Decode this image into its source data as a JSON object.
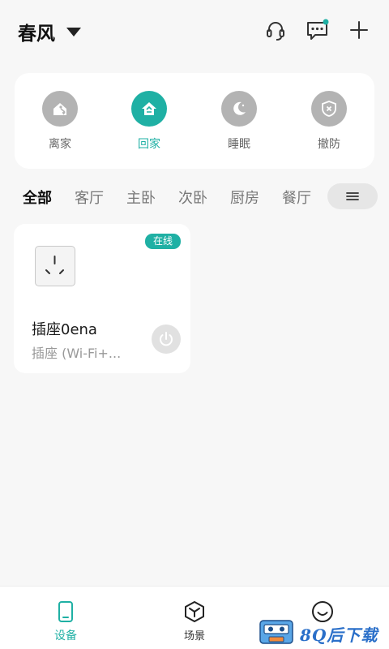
{
  "header": {
    "home_name": "春风",
    "icons": [
      "headset-icon",
      "message-icon",
      "plus-icon"
    ]
  },
  "modes": [
    {
      "label": "离家",
      "icon": "away-icon",
      "active": false
    },
    {
      "label": "回家",
      "icon": "home-icon",
      "active": true
    },
    {
      "label": "睡眠",
      "icon": "moon-icon",
      "active": false
    },
    {
      "label": "撤防",
      "icon": "shield-x-icon",
      "active": false
    }
  ],
  "rooms": {
    "tabs": [
      "全部",
      "客厅",
      "主卧",
      "次卧",
      "厨房",
      "餐厅"
    ],
    "active_index": 0,
    "menu_icon": "menu-icon"
  },
  "device": {
    "name": "插座0ena",
    "type": "插座 (Wi-Fi+...",
    "status": "在线"
  },
  "tabbar": {
    "items": [
      {
        "label": "设备",
        "icon": "phone-icon",
        "active": true
      },
      {
        "label": "场景",
        "icon": "cube-icon",
        "active": false
      },
      {
        "label": "",
        "icon": "smile-icon",
        "active": false
      }
    ]
  },
  "watermark": {
    "text": "8Q后下载"
  },
  "colors": {
    "accent": "#1fb0a4",
    "inactive_icon": "#b3b3b3",
    "background": "#f7f7f7"
  }
}
